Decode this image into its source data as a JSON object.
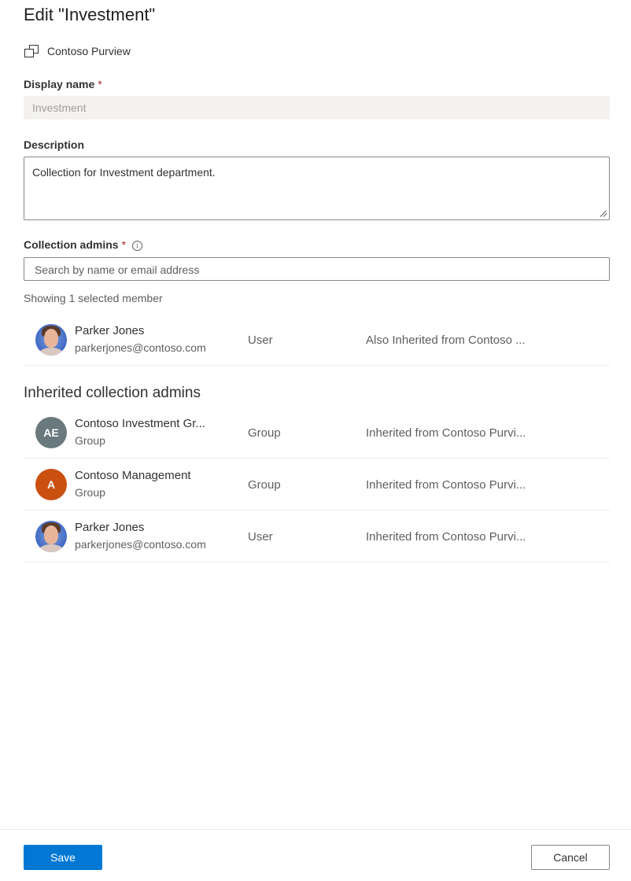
{
  "header": {
    "title": "Edit \"Investment\"",
    "breadcrumb": "Contoso Purview"
  },
  "form": {
    "display_name_label": "Display name",
    "required_marker": "*",
    "display_name_value": "Investment",
    "description_label": "Description",
    "description_value": "Collection for Investment department.",
    "admins_label": "Collection admins",
    "info_glyph": "i",
    "search_placeholder": "Search by name or email address",
    "showing_text": "Showing 1 selected member"
  },
  "selected_members": [
    {
      "name": "Parker Jones",
      "sub": "parkerjones@contoso.com",
      "type": "User",
      "inherited": "Also Inherited from Contoso ...",
      "avatar": "photo"
    }
  ],
  "inherited_section": {
    "title": "Inherited collection admins",
    "rows": [
      {
        "name": "Contoso Investment Gr...",
        "sub": "Group",
        "type": "Group",
        "inherited": "Inherited from Contoso Purvi...",
        "initials": "AE",
        "color": "#69797e"
      },
      {
        "name": "Contoso Management",
        "sub": "Group",
        "type": "Group",
        "inherited": "Inherited from Contoso Purvi...",
        "initials": "A",
        "color": "#ca5010"
      },
      {
        "name": "Parker Jones",
        "sub": "parkerjones@contoso.com",
        "type": "User",
        "inherited": "Inherited from Contoso Purvi...",
        "avatar": "photo"
      }
    ]
  },
  "footer": {
    "save_label": "Save",
    "cancel_label": "Cancel"
  },
  "colors": {
    "accent": "#0078d4",
    "required": "#a4262c"
  }
}
